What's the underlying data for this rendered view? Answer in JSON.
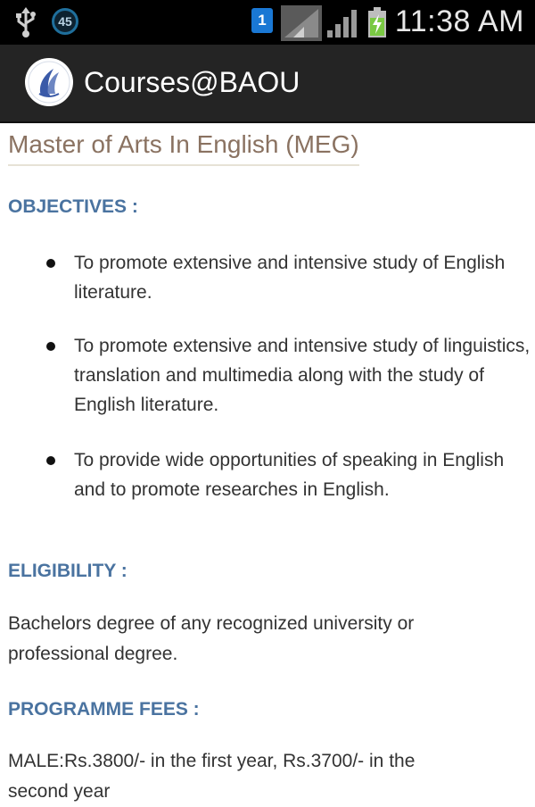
{
  "status_bar": {
    "notification_badge": "45",
    "sim_indicator": "1",
    "time": "11:38 AM",
    "icons": [
      "usb-icon",
      "notification-badge",
      "sim-icon",
      "signal-icon",
      "signal-icon",
      "battery-charging-icon"
    ]
  },
  "action_bar": {
    "app_title": "Courses@BAOU",
    "logo": "baou-logo-icon"
  },
  "course": {
    "title": "Master of Arts In English (MEG)",
    "objectives_heading": "OBJECTIVES :",
    "objectives": [
      {
        "line1": "To promote extensive and intensive study of English",
        "line2": "literature."
      },
      {
        "line1": "To promote extensive and intensive study of linguistics,",
        "line2": "translation and multimedia along with the study of",
        "line3": "English literature."
      },
      {
        "line1": "To provide wide opportunities of speaking in English",
        "line2": "and to promote researches in English."
      }
    ],
    "eligibility_heading": "ELIGIBILITY :",
    "eligibility_line1": "Bachelors degree of any recognized university or",
    "eligibility_line2": "professional degree.",
    "fees_heading": "PROGRAMME FEES :",
    "fees_line1": "MALE:Rs.3800/- in the first year, Rs.3700/- in the",
    "fees_line2": "second year"
  },
  "colors": {
    "title": "#8a7261",
    "heading": "#4a73a0",
    "action_bar": "#242424",
    "status_bar": "#000000"
  }
}
